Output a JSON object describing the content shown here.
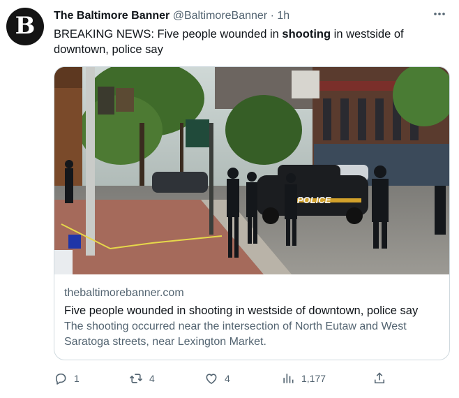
{
  "author": {
    "name": "The Baltimore Banner",
    "handle": "@BaltimoreBanner",
    "separator": "·",
    "time": "1h",
    "avatar_letter": "B"
  },
  "tweet": {
    "text_before": "BREAKING NEWS: Five people wounded in ",
    "text_bold": "shooting",
    "text_after": " in westside of downtown, police say"
  },
  "more_icon": "more-horizontal-icon",
  "card": {
    "image_icon": "news-photo",
    "domain": "thebaltimorebanner.com",
    "title": "Five people wounded in shooting in westside of downtown, police say",
    "description": "The shooting occurred near the intersection of North Eutaw and West Saratoga streets, near Lexington Market.",
    "photo_text": {
      "police": "POLICE"
    }
  },
  "actions": {
    "reply": {
      "icon": "reply-icon",
      "count": "1"
    },
    "retweet": {
      "icon": "retweet-icon",
      "count": "4"
    },
    "like": {
      "icon": "heart-icon",
      "count": "4"
    },
    "views": {
      "icon": "views-icon",
      "count": "1,177"
    },
    "share": {
      "icon": "share-icon"
    }
  },
  "colors": {
    "text": "#0f1419",
    "secondary": "#536471",
    "border": "#cfd9de"
  }
}
